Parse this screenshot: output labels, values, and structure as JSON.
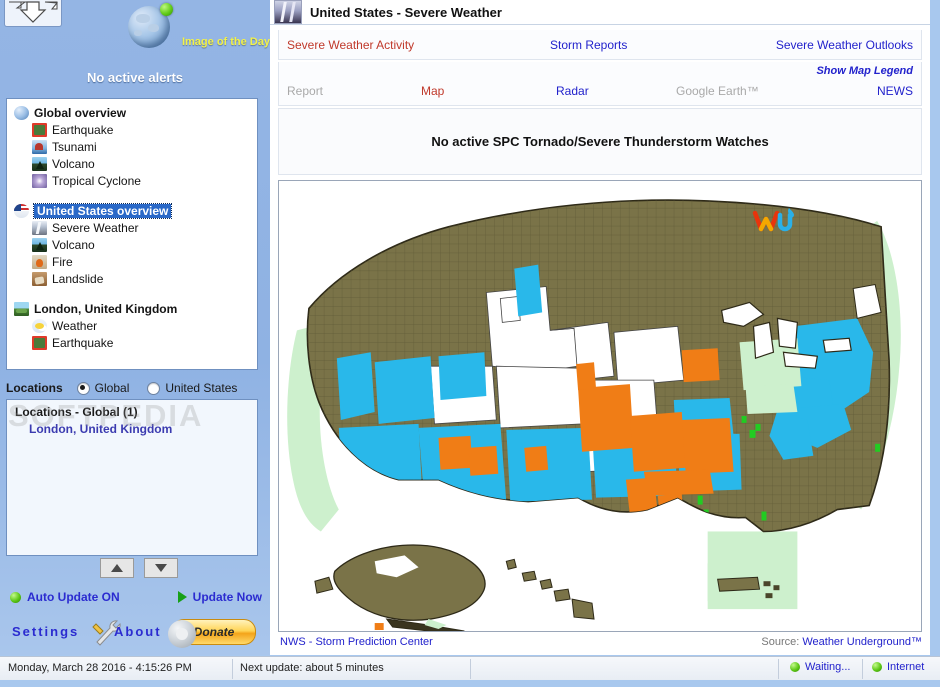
{
  "sidebar": {
    "image_of_the_day": "Image of the Day",
    "no_alerts": "No active alerts",
    "tree": [
      {
        "icon": "globe-icon",
        "label": "Global overview",
        "selected": false,
        "children": [
          {
            "icon": "earthquake-icon",
            "label": "Earthquake"
          },
          {
            "icon": "tsunami-icon",
            "label": "Tsunami"
          },
          {
            "icon": "volcano-icon",
            "label": "Volcano"
          },
          {
            "icon": "tropical-cyclone-icon",
            "label": "Tropical Cyclone"
          }
        ]
      },
      {
        "icon": "us-flag-icon",
        "label": "United States overview",
        "selected": true,
        "children": [
          {
            "icon": "severe-weather-icon",
            "label": "Severe Weather"
          },
          {
            "icon": "volcano-icon",
            "label": "Volcano"
          },
          {
            "icon": "fire-icon",
            "label": "Fire"
          },
          {
            "icon": "landslide-icon",
            "label": "Landslide"
          }
        ]
      },
      {
        "icon": "city-icon",
        "label": "London, United Kingdom",
        "selected": false,
        "children": [
          {
            "icon": "weather-icon",
            "label": "Weather"
          },
          {
            "icon": "earthquake-icon",
            "label": "Earthquake"
          }
        ]
      }
    ],
    "locations_switch": {
      "label": "Locations",
      "options": [
        {
          "label": "Global",
          "selected": true
        },
        {
          "label": "United States",
          "selected": false
        }
      ]
    },
    "locations_list": {
      "title": "Locations - Global (1)",
      "entries": [
        "London, United Kingdom"
      ]
    },
    "watermark": "SOFTPEDIA",
    "scroll_up": "▲",
    "scroll_down": "▼",
    "auto_update": "Auto Update ON",
    "update_now": "Update Now",
    "settings": "Settings",
    "about": "About",
    "donate": "Donate"
  },
  "main": {
    "title": "United States - Severe Weather",
    "tabs_primary": [
      {
        "label": "Severe Weather Activity",
        "state": "active"
      },
      {
        "label": "Storm Reports",
        "state": "link"
      },
      {
        "label": "Severe Weather Outlooks",
        "state": "link"
      }
    ],
    "tabs_secondary": [
      {
        "label": "Report",
        "state": "dim"
      },
      {
        "label": "Map",
        "state": "active"
      },
      {
        "label": "Radar",
        "state": "link"
      },
      {
        "label": "Google Earth™",
        "state": "dim"
      },
      {
        "label": "NEWS",
        "state": "link"
      }
    ],
    "show_map_legend": "Show Map Legend",
    "watch_message": "No active SPC Tornado/Severe Thunderstorm Watches",
    "map_credit_left": "NWS - Storm Prediction Center",
    "map_source_prefix": "Source: ",
    "map_source_name": "Weather Underground™",
    "logo": "wu-logo"
  },
  "statusbar": {
    "datetime": "Monday, March 28 2016 - 4:15:26 PM",
    "next_update": "Next update: about 5 minutes",
    "waiting": "Waiting...",
    "internet": "Internet"
  },
  "colors": {
    "sidebar_blue": "#8fb2e3",
    "selection_blue": "#2a69c8",
    "link_blue": "#2222cc",
    "active_red": "#c0392b",
    "map_land": "#7a7348",
    "map_cyan": "#29b8ea",
    "map_orange": "#f07d16",
    "map_white": "#ffffff",
    "map_green": "#c9f0c9",
    "map_bright_green": "#22cc22",
    "status_green": "#5cc715"
  }
}
